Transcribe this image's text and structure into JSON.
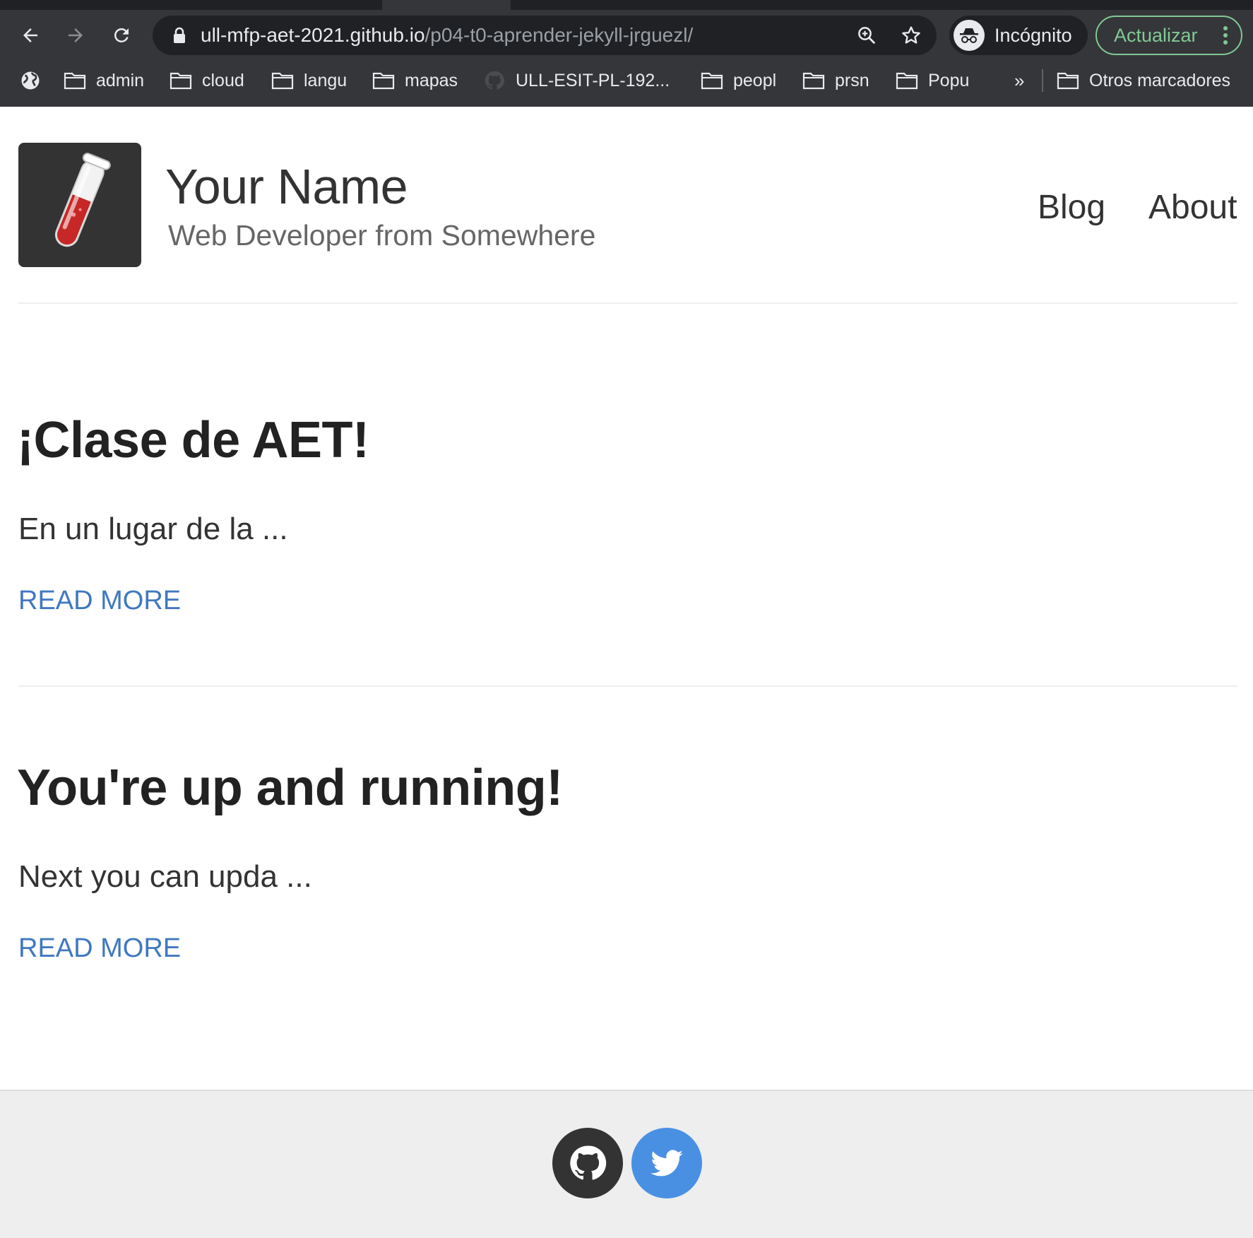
{
  "browser": {
    "url_host": "ull-mfp-aet-2021.github.io",
    "url_path": "/p04-t0-aprender-jekyll-jrguezl/",
    "incognito_label": "Incógnito",
    "update_label": "Actualizar",
    "bookmarks": [
      {
        "label": "admin",
        "icon": "folder-icon"
      },
      {
        "label": "cloud",
        "icon": "folder-icon"
      },
      {
        "label": "langu",
        "icon": "folder-icon"
      },
      {
        "label": "mapas",
        "icon": "folder-icon"
      },
      {
        "label": "ULL-ESIT-PL-192...",
        "icon": "github-icon"
      },
      {
        "label": "peopl",
        "icon": "folder-icon"
      },
      {
        "label": "prsn",
        "icon": "folder-icon"
      },
      {
        "label": "Popu",
        "icon": "folder-icon"
      }
    ],
    "overflow_label": "»",
    "other_bookmarks_label": "Otros marcadores"
  },
  "site": {
    "title": "Your Name",
    "subtitle": "Web Developer from Somewhere",
    "nav": [
      "Blog",
      "About"
    ]
  },
  "posts": [
    {
      "title": "¡Clase de AET!",
      "excerpt": "En un lugar de la ...",
      "read_more": "READ MORE"
    },
    {
      "title": "You're up and running!",
      "excerpt": "Next you can upda ...",
      "read_more": "READ MORE"
    }
  ],
  "footer": {
    "social": [
      "github-icon",
      "twitter-icon"
    ]
  },
  "colors": {
    "chrome_bg": "#35363a",
    "link": "#4078c0",
    "update_green": "#81c995",
    "twitter_blue": "#4a90e2"
  }
}
